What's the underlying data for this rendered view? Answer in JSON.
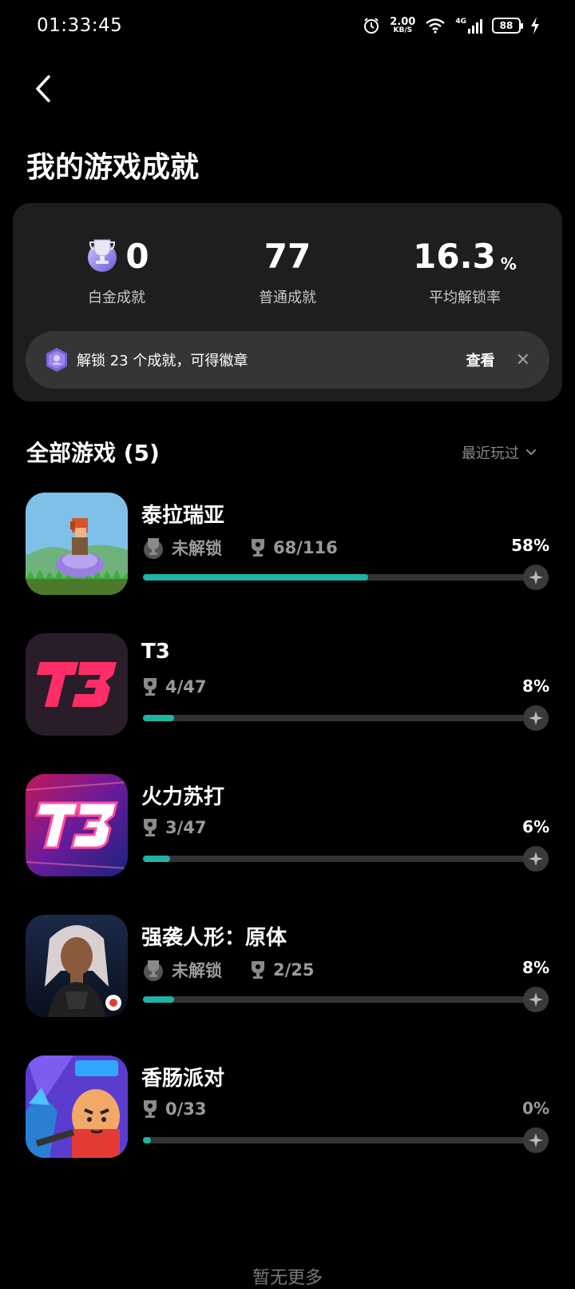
{
  "status_bar": {
    "time": "01:33:45",
    "net_speed_value": "2.00",
    "net_speed_unit": "KB/S",
    "network": "4G",
    "battery": "88",
    "icons": [
      "alarm-icon",
      "wifi-icon",
      "signal-icon",
      "battery-icon",
      "charging-icon"
    ]
  },
  "header": {
    "title": "我的游戏成就"
  },
  "summary": {
    "platinum": {
      "value": "0",
      "label": "白金成就"
    },
    "normal": {
      "value": "77",
      "label": "普通成就"
    },
    "average": {
      "value": "16.3",
      "unit": "%",
      "label": "平均解锁率"
    },
    "banner": {
      "text": "解锁 23 个成就，可得徽章",
      "view": "查看",
      "close": "✕"
    }
  },
  "games_section": {
    "title": "全部游戏 (5)",
    "sort": "最近玩过"
  },
  "games": [
    {
      "name": "泰拉瑞亚",
      "platinum_status": "未解锁",
      "achievements": "68/116",
      "percent": "58%",
      "progress": 0.58
    },
    {
      "name": "T3",
      "achievements": "4/47",
      "percent": "8%",
      "progress": 0.08
    },
    {
      "name": "火力苏打",
      "achievements": "3/47",
      "percent": "6%",
      "progress": 0.06
    },
    {
      "name": "强袭人形：原体",
      "platinum_status": "未解锁",
      "achievements": "2/25",
      "percent": "8%",
      "progress": 0.08
    },
    {
      "name": "香肠派对",
      "achievements": "0/33",
      "percent": "0%",
      "progress": 0.0
    }
  ],
  "footer": {
    "text": "暂无更多"
  },
  "colors": {
    "background": "#000000",
    "card": "#1e1e1e",
    "progress": "#1db4a6"
  }
}
